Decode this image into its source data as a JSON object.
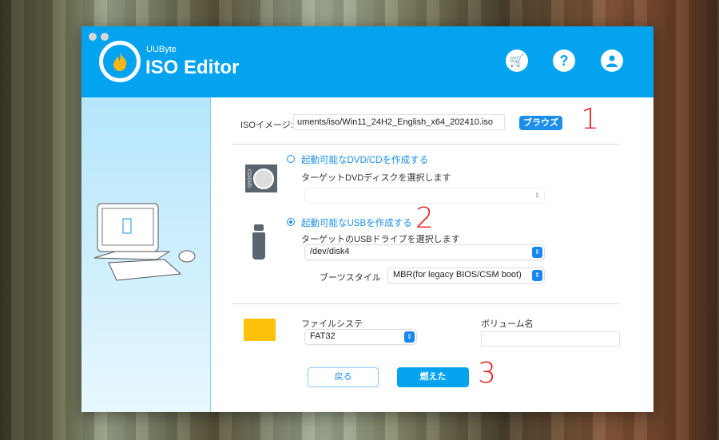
{
  "app": {
    "brand": "UUByte",
    "title": "ISO Editor"
  },
  "header_icons": [
    "cart-icon",
    "help-icon",
    "account-icon"
  ],
  "iso": {
    "label": "ISOイメージ:",
    "value": "uments/iso/Win11_24H2_English_x64_202410.iso",
    "browse": "ブラウズ"
  },
  "dvd": {
    "option": "起動可能なDVD/CDを作成する",
    "target_label": "ターゲットDVDディスクを選択します",
    "selected": "",
    "icon_text": "CD/DVD"
  },
  "usb": {
    "option": "起動可能なUSBを作成する",
    "target_label": "ターゲットのUSBドライブを選択します",
    "selected": "/dev/disk4",
    "boot_style_label": "ブーツスタイル",
    "boot_style": "MBR(for legacy BIOS/CSM boot)"
  },
  "filesystem": {
    "label": "ファイルシステ",
    "value": "FAT32"
  },
  "volume": {
    "label": "ボリューム名",
    "value": ""
  },
  "buttons": {
    "back": "戻る",
    "burn": "燃えた"
  },
  "annotations": [
    "1",
    "2",
    "3"
  ],
  "colors": {
    "accent": "#03a3f0",
    "annotation": "#e02020"
  }
}
